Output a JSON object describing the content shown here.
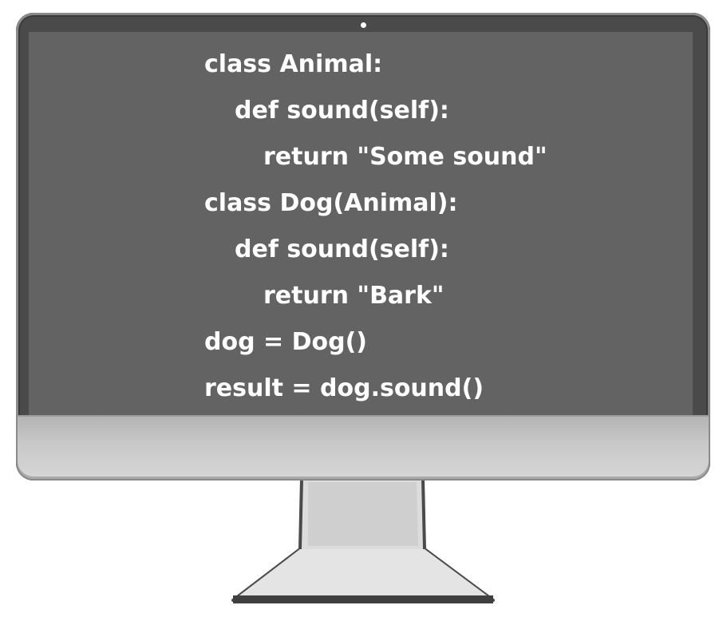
{
  "code": {
    "language": "python",
    "lines": [
      "class Animal:",
      "def sound(self):",
      "return \"Some sound\"",
      "class Dog(Animal):",
      "def sound(self):",
      "return \"Bark\"",
      "dog = Dog()",
      "result = dog.sound()"
    ]
  },
  "colors": {
    "screen": "#636363",
    "bezel": "#4a4a4a",
    "chin": "#c9c9c9",
    "text": "#ffffff"
  }
}
